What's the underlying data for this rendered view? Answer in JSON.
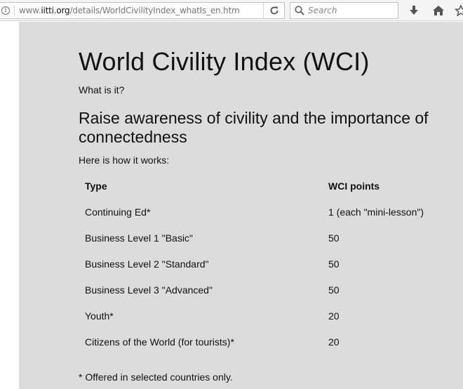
{
  "browser": {
    "url_prefix": "www.",
    "url_host": "iitti.org",
    "url_path": "/details/WorldCivilityIndex_whatIs_en.htm",
    "info_glyph": "i",
    "search_placeholder": "Search",
    "icons": [
      "info-icon",
      "reload-icon",
      "search-icon",
      "download-icon",
      "home-icon",
      "bookmark-star-icon"
    ]
  },
  "page": {
    "title": "World Civility Index (WCI)",
    "subtitle": "What is it?",
    "heading": "Raise awareness of civility and the importance of connectedness",
    "intro": "Here is how it works:",
    "table": {
      "headers": [
        "Type",
        "WCI points"
      ],
      "rows": [
        [
          "Continuing Ed*",
          "1 (each \"mini-lesson\")"
        ],
        [
          "Business Level 1 \"Basic\"",
          "50"
        ],
        [
          "Business Level 2 \"Standard\"",
          "50"
        ],
        [
          "Business Level 3 \"Advanced\"",
          "50"
        ],
        [
          "Youth*",
          "20"
        ],
        [
          "Citizens of the World (for tourists)*",
          "20"
        ]
      ]
    },
    "footnote": "* Offered in selected countries only.",
    "colors": {
      "background": "#dcdcdc",
      "text": "#111111"
    }
  }
}
